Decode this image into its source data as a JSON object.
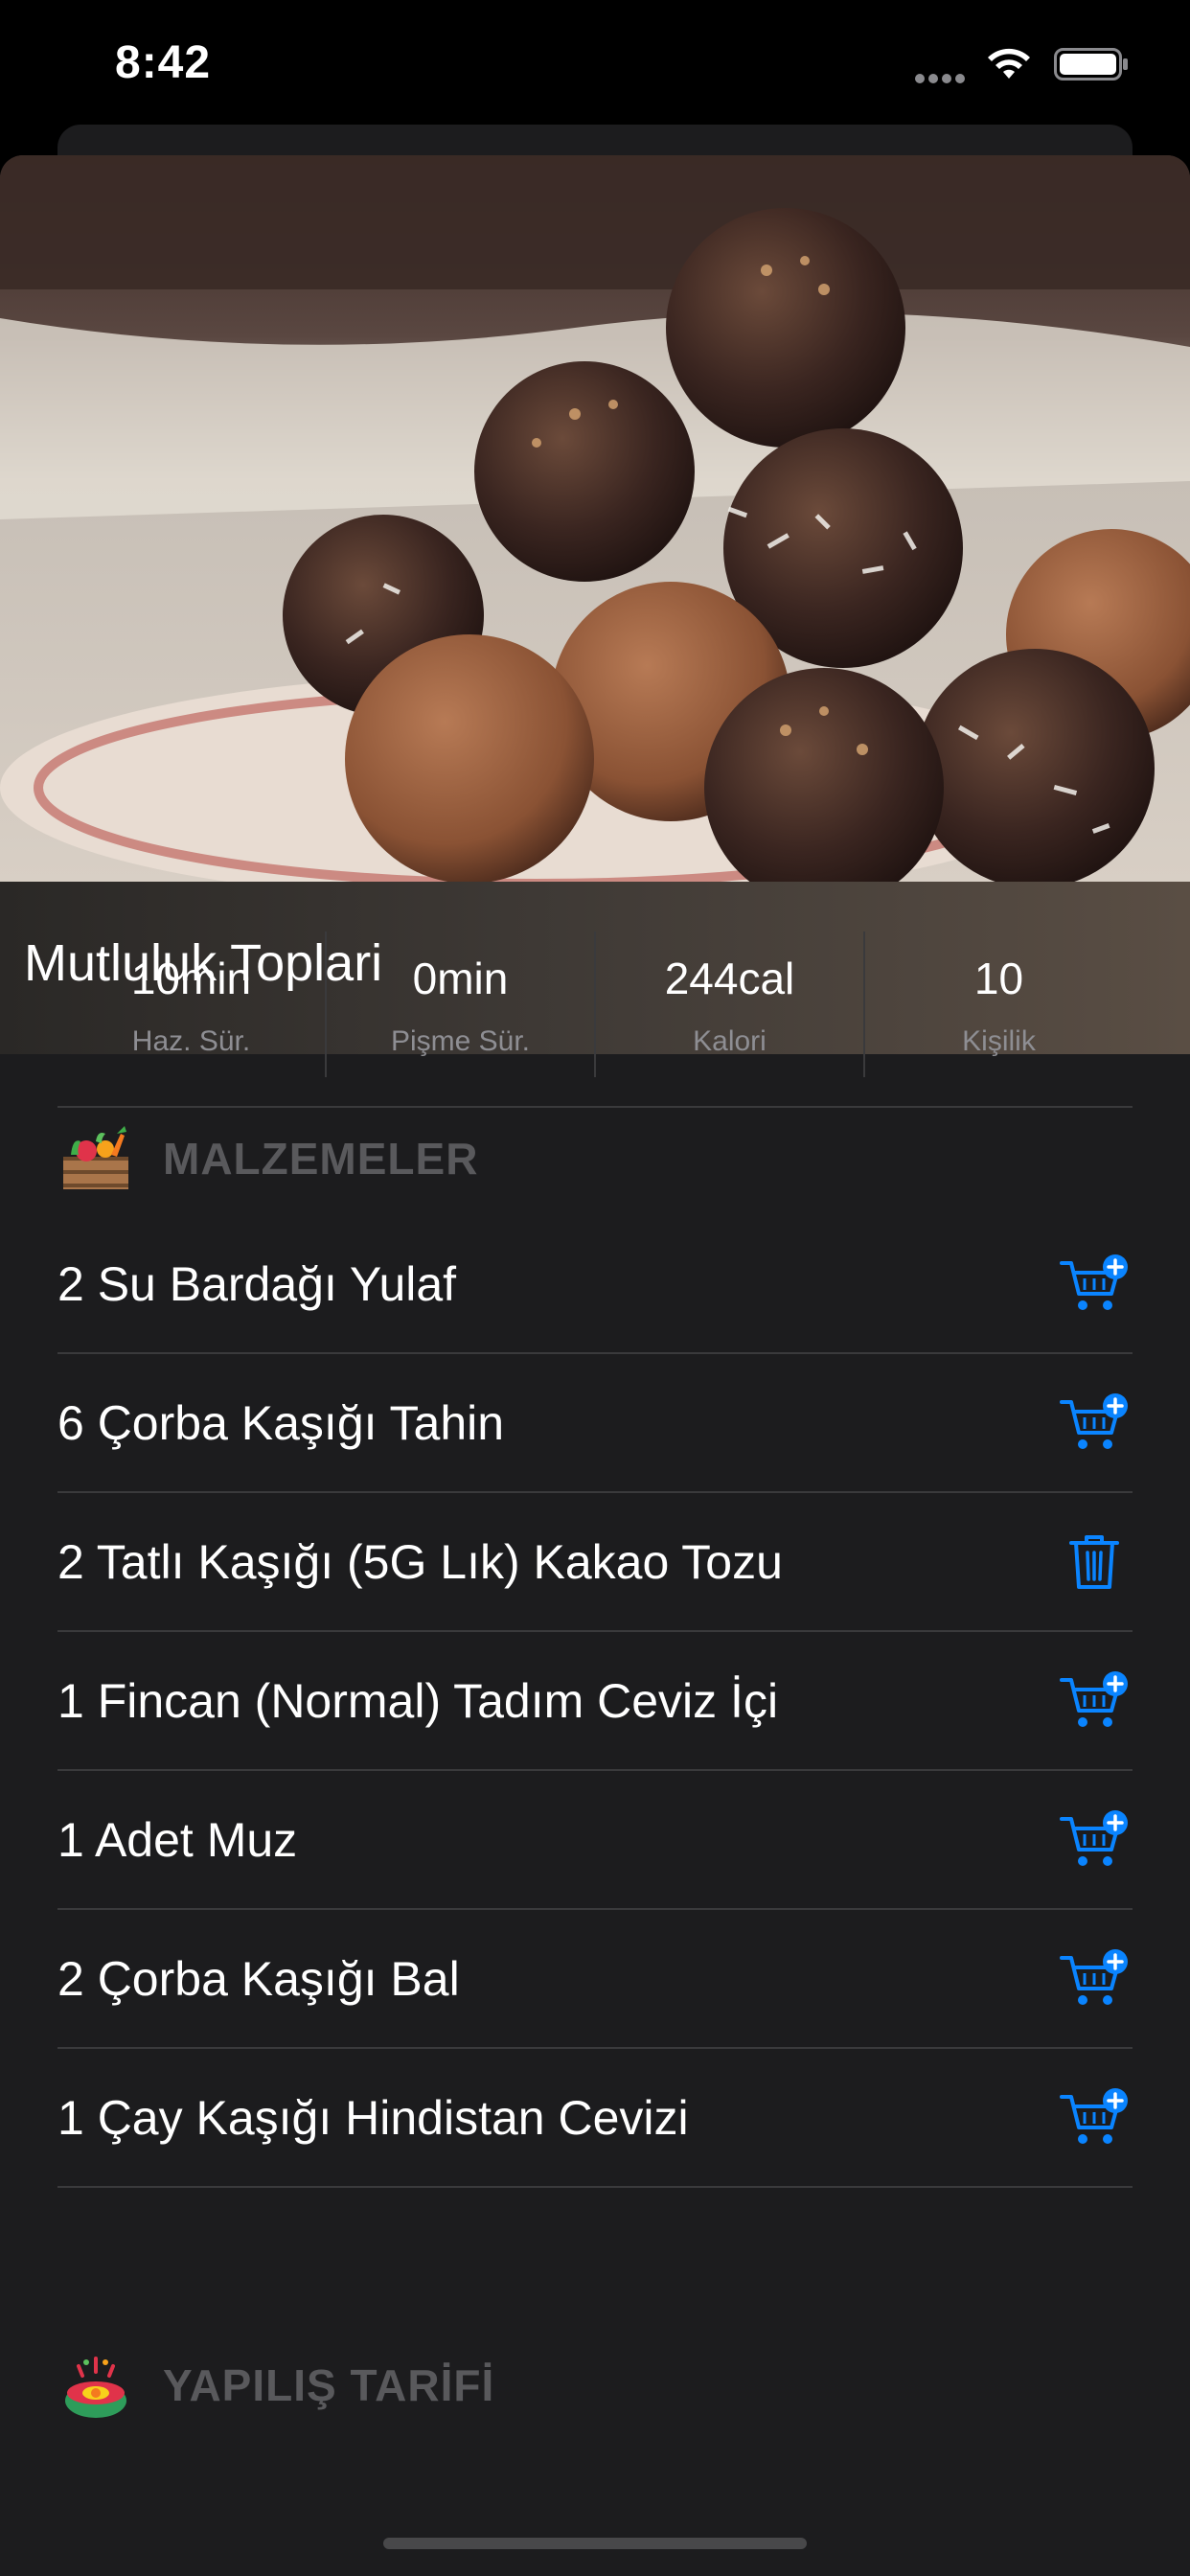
{
  "status": {
    "time": "8:42"
  },
  "recipe": {
    "title": "Mutluluk Toplari"
  },
  "stats": [
    {
      "value": "10min",
      "label": "Haz. Sür."
    },
    {
      "value": "0min",
      "label": "Pişme Sür."
    },
    {
      "value": "244cal",
      "label": "Kalori"
    },
    {
      "value": "10",
      "label": "Kişilik"
    }
  ],
  "sections": {
    "ingredients": "MALZEMELER",
    "preparation": "YAPILIŞ TARİFİ"
  },
  "ingredients": [
    {
      "text": "2 Su Bardağı Yulaf",
      "action": "cart-add-icon"
    },
    {
      "text": "6 Çorba Kaşığı Tahin",
      "action": "cart-add-icon"
    },
    {
      "text": "2 Tatlı Kaşığı (5G Lık) Kakao Tozu",
      "action": "trash-icon"
    },
    {
      "text": "1 Fincan (Normal) Tadım Ceviz İçi",
      "action": "cart-add-icon"
    },
    {
      "text": "1 Adet Muz",
      "action": "cart-add-icon"
    },
    {
      "text": "2 Çorba Kaşığı Bal",
      "action": "cart-add-icon"
    },
    {
      "text": "1 Çay Kaşığı Hindistan Cevizi",
      "action": "cart-add-icon"
    }
  ],
  "colors": {
    "accent": "#0a84ff",
    "background": "#1c1c1e",
    "section_title": "#59595c",
    "secondary_text": "#8e8e93"
  }
}
